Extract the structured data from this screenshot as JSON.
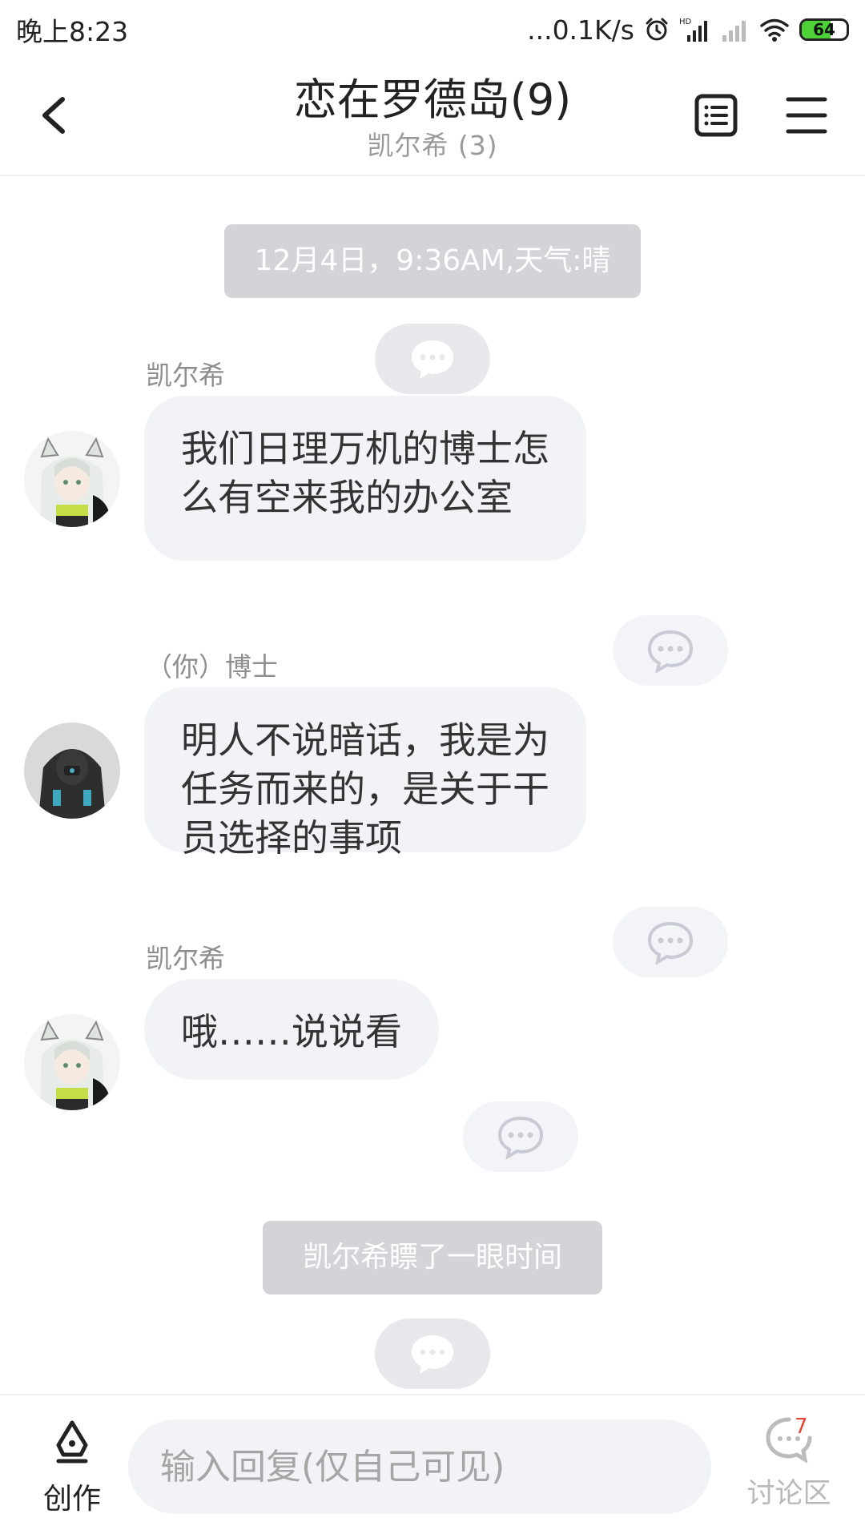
{
  "status_bar": {
    "time": "晚上8:23",
    "network_speed": "...0.1K/s",
    "battery": "64",
    "battery_level": 0.64,
    "icons": [
      "alarm-icon",
      "hd-signal-icon",
      "signal-icon",
      "wifi-icon",
      "battery-icon"
    ]
  },
  "header": {
    "title": "恋在罗德岛(9)",
    "subtitle": "凯尔希 (3)"
  },
  "chat": {
    "system_1": "12月4日，9:36AM,天气:晴",
    "messages": [
      {
        "sender": "凯尔希",
        "text": "我们日理万机的博士怎么有空来我的办公室"
      },
      {
        "sender": "（你）博士",
        "text": "明人不说暗话，我是为任务而来的，是关于干员选择的事项"
      },
      {
        "sender": "凯尔希",
        "text": "哦……说说看"
      }
    ],
    "system_2": "凯尔希瞟了一眼时间"
  },
  "bottom": {
    "create_label": "创作",
    "input_placeholder": "输入回复(仅自己可见)",
    "discuss_label": "讨论区",
    "discuss_badge": "7"
  },
  "colors": {
    "system_pill": "#d3d3d8",
    "bubble": "#f2f3f7",
    "badge": "#e0492f",
    "battery": "#4cd137"
  }
}
